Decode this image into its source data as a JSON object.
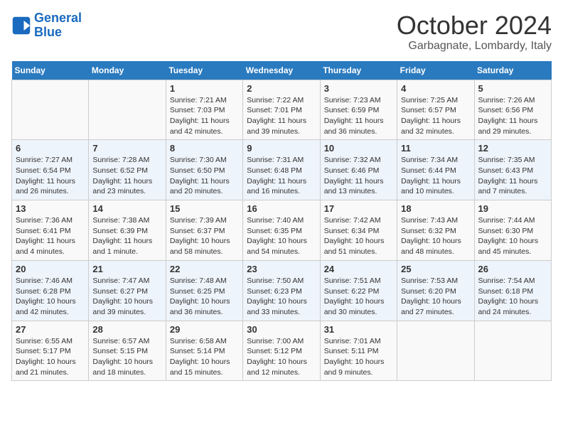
{
  "header": {
    "logo_line1": "General",
    "logo_line2": "Blue",
    "month_title": "October 2024",
    "location": "Garbagnate, Lombardy, Italy"
  },
  "days_of_week": [
    "Sunday",
    "Monday",
    "Tuesday",
    "Wednesday",
    "Thursday",
    "Friday",
    "Saturday"
  ],
  "weeks": [
    [
      {
        "day": "",
        "info": ""
      },
      {
        "day": "",
        "info": ""
      },
      {
        "day": "1",
        "info": "Sunrise: 7:21 AM\nSunset: 7:03 PM\nDaylight: 11 hours and 42 minutes."
      },
      {
        "day": "2",
        "info": "Sunrise: 7:22 AM\nSunset: 7:01 PM\nDaylight: 11 hours and 39 minutes."
      },
      {
        "day": "3",
        "info": "Sunrise: 7:23 AM\nSunset: 6:59 PM\nDaylight: 11 hours and 36 minutes."
      },
      {
        "day": "4",
        "info": "Sunrise: 7:25 AM\nSunset: 6:57 PM\nDaylight: 11 hours and 32 minutes."
      },
      {
        "day": "5",
        "info": "Sunrise: 7:26 AM\nSunset: 6:56 PM\nDaylight: 11 hours and 29 minutes."
      }
    ],
    [
      {
        "day": "6",
        "info": "Sunrise: 7:27 AM\nSunset: 6:54 PM\nDaylight: 11 hours and 26 minutes."
      },
      {
        "day": "7",
        "info": "Sunrise: 7:28 AM\nSunset: 6:52 PM\nDaylight: 11 hours and 23 minutes."
      },
      {
        "day": "8",
        "info": "Sunrise: 7:30 AM\nSunset: 6:50 PM\nDaylight: 11 hours and 20 minutes."
      },
      {
        "day": "9",
        "info": "Sunrise: 7:31 AM\nSunset: 6:48 PM\nDaylight: 11 hours and 16 minutes."
      },
      {
        "day": "10",
        "info": "Sunrise: 7:32 AM\nSunset: 6:46 PM\nDaylight: 11 hours and 13 minutes."
      },
      {
        "day": "11",
        "info": "Sunrise: 7:34 AM\nSunset: 6:44 PM\nDaylight: 11 hours and 10 minutes."
      },
      {
        "day": "12",
        "info": "Sunrise: 7:35 AM\nSunset: 6:43 PM\nDaylight: 11 hours and 7 minutes."
      }
    ],
    [
      {
        "day": "13",
        "info": "Sunrise: 7:36 AM\nSunset: 6:41 PM\nDaylight: 11 hours and 4 minutes."
      },
      {
        "day": "14",
        "info": "Sunrise: 7:38 AM\nSunset: 6:39 PM\nDaylight: 11 hours and 1 minute."
      },
      {
        "day": "15",
        "info": "Sunrise: 7:39 AM\nSunset: 6:37 PM\nDaylight: 10 hours and 58 minutes."
      },
      {
        "day": "16",
        "info": "Sunrise: 7:40 AM\nSunset: 6:35 PM\nDaylight: 10 hours and 54 minutes."
      },
      {
        "day": "17",
        "info": "Sunrise: 7:42 AM\nSunset: 6:34 PM\nDaylight: 10 hours and 51 minutes."
      },
      {
        "day": "18",
        "info": "Sunrise: 7:43 AM\nSunset: 6:32 PM\nDaylight: 10 hours and 48 minutes."
      },
      {
        "day": "19",
        "info": "Sunrise: 7:44 AM\nSunset: 6:30 PM\nDaylight: 10 hours and 45 minutes."
      }
    ],
    [
      {
        "day": "20",
        "info": "Sunrise: 7:46 AM\nSunset: 6:28 PM\nDaylight: 10 hours and 42 minutes."
      },
      {
        "day": "21",
        "info": "Sunrise: 7:47 AM\nSunset: 6:27 PM\nDaylight: 10 hours and 39 minutes."
      },
      {
        "day": "22",
        "info": "Sunrise: 7:48 AM\nSunset: 6:25 PM\nDaylight: 10 hours and 36 minutes."
      },
      {
        "day": "23",
        "info": "Sunrise: 7:50 AM\nSunset: 6:23 PM\nDaylight: 10 hours and 33 minutes."
      },
      {
        "day": "24",
        "info": "Sunrise: 7:51 AM\nSunset: 6:22 PM\nDaylight: 10 hours and 30 minutes."
      },
      {
        "day": "25",
        "info": "Sunrise: 7:53 AM\nSunset: 6:20 PM\nDaylight: 10 hours and 27 minutes."
      },
      {
        "day": "26",
        "info": "Sunrise: 7:54 AM\nSunset: 6:18 PM\nDaylight: 10 hours and 24 minutes."
      }
    ],
    [
      {
        "day": "27",
        "info": "Sunrise: 6:55 AM\nSunset: 5:17 PM\nDaylight: 10 hours and 21 minutes."
      },
      {
        "day": "28",
        "info": "Sunrise: 6:57 AM\nSunset: 5:15 PM\nDaylight: 10 hours and 18 minutes."
      },
      {
        "day": "29",
        "info": "Sunrise: 6:58 AM\nSunset: 5:14 PM\nDaylight: 10 hours and 15 minutes."
      },
      {
        "day": "30",
        "info": "Sunrise: 7:00 AM\nSunset: 5:12 PM\nDaylight: 10 hours and 12 minutes."
      },
      {
        "day": "31",
        "info": "Sunrise: 7:01 AM\nSunset: 5:11 PM\nDaylight: 10 hours and 9 minutes."
      },
      {
        "day": "",
        "info": ""
      },
      {
        "day": "",
        "info": ""
      }
    ]
  ]
}
